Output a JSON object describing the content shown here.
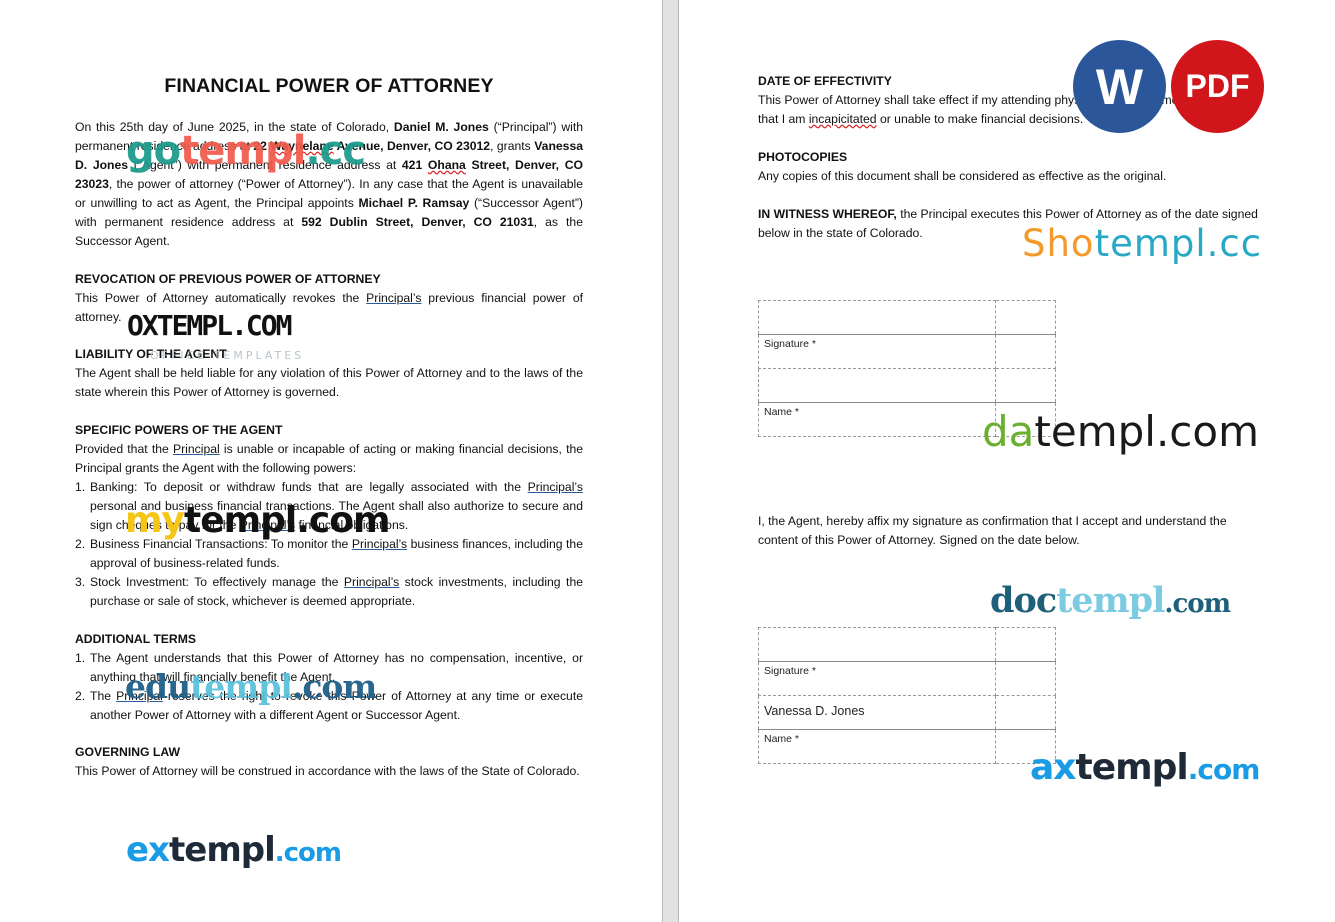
{
  "document": {
    "title": "FINANCIAL POWER OF ATTORNEY",
    "intro": {
      "p1": "On this 25th day of June 2025, in the state of Colorado, ",
      "principal_name": "Daniel M. Jones",
      "p2": " (“Principal”) with permanent residence address at ",
      "principal_address_pre": "22 ",
      "principal_address_squig": "Waynelane",
      "principal_address_post": " Avenue, Denver, CO 23012",
      "p3": ", grants ",
      "agent_name": "Vanessa D. Jones",
      "p4": " (“Agent”) with permanent residence address at ",
      "agent_address_pre": "421 ",
      "agent_address_squig": "Ohana",
      "agent_address_post": " Street, Denver, CO 23023",
      "p5": ", the power of attorney (“Power of Attorney”). In any case that the Agent is unavailable or unwilling to act as Agent, the Principal appoints ",
      "successor_name": "Michael P. Ramsay",
      "p6": " (“Successor Agent”) with permanent residence address at ",
      "successor_address": "592 Dublin Street, Denver, CO 21031",
      "p7": ", as the Successor Agent."
    },
    "revocation": {
      "heading": "REVOCATION OF PREVIOUS POWER OF ATTORNEY",
      "t1": "This Power of Attorney automatically revokes the ",
      "link": "Principal’s",
      "t2": " previous financial power of attorney."
    },
    "liability": {
      "heading": "LIABILITY OF THE AGENT",
      "text": "The Agent shall be held liable for any violation of this Power of Attorney and to the laws of the state wherein this Power of Attorney is governed."
    },
    "specific_powers": {
      "heading": "SPECIFIC POWERS OF THE AGENT",
      "t1": "Provided that the ",
      "link": "Principal",
      "t2": " is unable or incapable of acting or making financial decisions, the Principal grants the Agent with the following powers:",
      "items": [
        {
          "num": "1.",
          "a": "Banking: To deposit or withdraw funds that are legally associated with the ",
          "link": "Principal’s",
          "b": " personal and business financial transactions. The Agent shall also authorize to secure and sign cheques to pay for the ",
          "link2": "Principal’s",
          "c": " financial obligations."
        },
        {
          "num": "2.",
          "a": "Business Financial Transactions: To monitor the ",
          "link": "Principal’s",
          "b": " business finances, including the approval of business-related funds."
        },
        {
          "num": "3.",
          "a": "Stock Investment: To effectively manage the ",
          "link": "Principal’s",
          "b": " stock investments, including the purchase or sale of stock, whichever is deemed appropriate."
        }
      ]
    },
    "additional_terms": {
      "heading": "ADDITIONAL TERMS",
      "items": [
        {
          "num": "1.",
          "a": "The Agent understands that this Power of Attorney has no compensation, incentive, or anything that will financially benefit the Agent."
        },
        {
          "num": "2.",
          "a": "The ",
          "link": "Principal",
          "b": " reserves the right to revoke this Power of Attorney at any time or execute another Power of Attorney with a different Agent or Successor Agent."
        }
      ]
    },
    "governing_law": {
      "heading": "GOVERNING LAW",
      "text": "This Power of Attorney will be construed in accordance with the laws of the State of Colorado."
    },
    "date_of_effectivity": {
      "heading": "DATE OF EFFECTIVITY",
      "t1": "This Power of Attorney shall take effect if my attending physician has confirmed, in writing, that I am ",
      "squig": "incapicitated",
      "t2": " or unable to make financial decisions."
    },
    "photocopies": {
      "heading": "PHOTOCOPIES",
      "text": "Any copies of this document shall be considered as effective as the original."
    },
    "witness": {
      "bold": "IN WITNESS WHEREOF,",
      "text": " the Principal executes this Power of Attorney as of the date signed below in the state of Colorado."
    },
    "principal_signature_table": {
      "signature_label": "Signature *",
      "name_label": "Name *",
      "signature_value": "",
      "name_value": ""
    },
    "agent_statement": "I, the Agent, hereby affix my signature as confirmation that I accept and understand the content of this Power of Attorney. Signed on the date below.",
    "agent_signature_table": {
      "signature_label": "Signature *",
      "name_label": "Name *",
      "signature_value": "",
      "name_value": "Vanessa D. Jones"
    }
  },
  "badges": {
    "word": {
      "label": "W",
      "color": "#2b579a"
    },
    "pdf": {
      "label": "PDF",
      "color": "#d0161b"
    }
  },
  "watermarks": {
    "gotempl": {
      "a": "go",
      "b": "templ",
      "c": ".cc",
      "color_a": "#1a9a8a",
      "color_b": "#f05a4a",
      "color_c": "#1a9a8a"
    },
    "oxtempl": {
      "main": "OXTEMPL.COM",
      "sub": "OFFICE TEMPLATES"
    },
    "mytempl": {
      "a": "my",
      "b": "templ.com",
      "color_a": "#f5c518",
      "color_b": "#111111"
    },
    "edutempl": {
      "a": "edu",
      "b": "templ",
      "c": ".com",
      "color_a": "#1e5f8a",
      "color_b": "#5cc0dc",
      "color_c": "#1e5f8a"
    },
    "extempl": {
      "a": "ex",
      "b": "templ",
      "c": ".com",
      "color_a": "#1a9be6",
      "color_b": "#1e2a38",
      "color_c": "#1a9be6"
    },
    "shotempl": {
      "a": "Sho",
      "b": "templ.cc",
      "color_a": "#f39a2b",
      "color_b": "#27a9c6"
    },
    "datempl": {
      "a": "da",
      "b": "templ.com",
      "color_a": "#6ab02e",
      "color_b": "#1a1a1a"
    },
    "doctempl": {
      "a": "doc",
      "b": "templ",
      "c": ".com",
      "color_a": "#1e5f7a",
      "color_b": "#7ccbe0",
      "color_c": "#1e5f7a"
    },
    "axtempl": {
      "a": "ax",
      "b": "templ",
      "c": ".com",
      "color_a": "#1a9be6",
      "color_b": "#1e2a38",
      "color_c": "#1a9be6"
    }
  }
}
